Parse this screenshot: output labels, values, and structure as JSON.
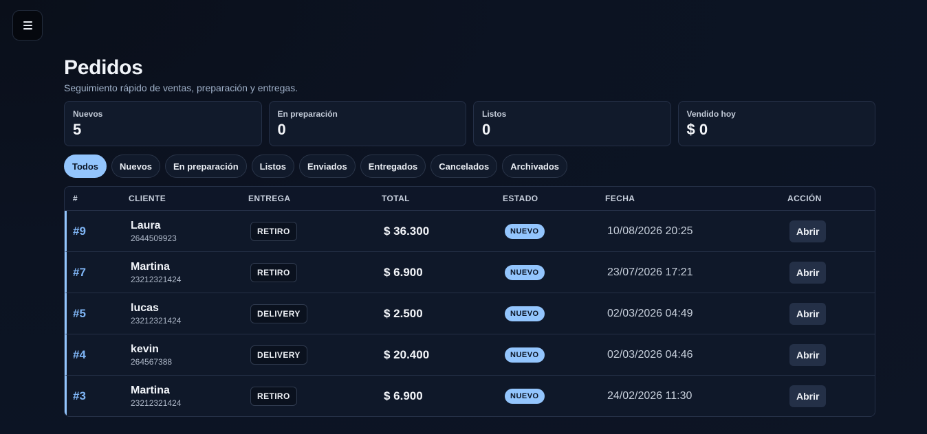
{
  "menu": {
    "icon": "menu-icon"
  },
  "header": {
    "title": "Pedidos",
    "subtitle": "Seguimiento rápido de ventas, preparación y entregas."
  },
  "stats": [
    {
      "label": "Nuevos",
      "value": "5"
    },
    {
      "label": "En preparación",
      "value": "0"
    },
    {
      "label": "Listos",
      "value": "0"
    },
    {
      "label": "Vendido hoy",
      "value": "$ 0"
    }
  ],
  "filters": [
    {
      "label": "Todos",
      "active": true
    },
    {
      "label": "Nuevos",
      "active": false
    },
    {
      "label": "En preparación",
      "active": false
    },
    {
      "label": "Listos",
      "active": false
    },
    {
      "label": "Enviados",
      "active": false
    },
    {
      "label": "Entregados",
      "active": false
    },
    {
      "label": "Cancelados",
      "active": false
    },
    {
      "label": "Archivados",
      "active": false
    }
  ],
  "table": {
    "columns": [
      "#",
      "CLIENTE",
      "ENTREGA",
      "TOTAL",
      "ESTADO",
      "FECHA",
      "ACCIÓN"
    ],
    "rows": [
      {
        "num": "#9",
        "name": "Laura",
        "phone": "2644509923",
        "delivery": "RETIRO",
        "total": "$ 36.300",
        "status": "NUEVO",
        "date": "10/08/2026 20:25",
        "action": "Abrir"
      },
      {
        "num": "#7",
        "name": "Martina",
        "phone": "23212321424",
        "delivery": "RETIRO",
        "total": "$ 6.900",
        "status": "NUEVO",
        "date": "23/07/2026 17:21",
        "action": "Abrir"
      },
      {
        "num": "#5",
        "name": "lucas",
        "phone": "23212321424",
        "delivery": "DELIVERY",
        "total": "$ 2.500",
        "status": "NUEVO",
        "date": "02/03/2026 04:49",
        "action": "Abrir"
      },
      {
        "num": "#4",
        "name": "kevin",
        "phone": "264567388",
        "delivery": "DELIVERY",
        "total": "$ 20.400",
        "status": "NUEVO",
        "date": "02/03/2026 04:46",
        "action": "Abrir"
      },
      {
        "num": "#3",
        "name": "Martina",
        "phone": "23212321424",
        "delivery": "RETIRO",
        "total": "$ 6.900",
        "status": "NUEVO",
        "date": "24/02/2026 11:30",
        "action": "Abrir"
      }
    ]
  },
  "colors": {
    "background": "#0c1322",
    "accent": "#93c5fd",
    "card": "#111a2b",
    "border": "#253047"
  }
}
